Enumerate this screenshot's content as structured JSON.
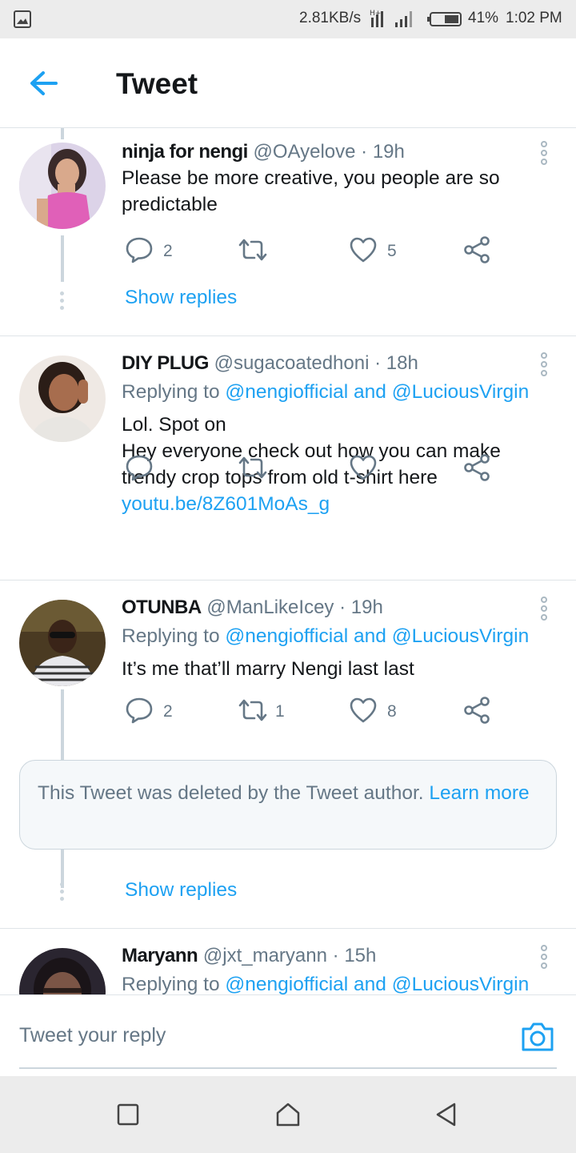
{
  "status_bar": {
    "net_speed": "2.81KB/s",
    "battery_percent": "41%",
    "time": "1:02 PM",
    "icons": [
      "image-icon",
      "signal-icon",
      "battery-icon"
    ]
  },
  "app_bar": {
    "title": "Tweet",
    "back_icon": "arrow-left-icon"
  },
  "colors": {
    "accent": "#1da1f2",
    "secondary_text": "#657786",
    "divider": "#dfe4e8",
    "primary_text": "#14171a"
  },
  "tweets": [
    {
      "name": "ninja for nengi",
      "handle": "@OAyelove",
      "sep": "·",
      "time": "19h",
      "text": "Please be more creative, you people are so predictable",
      "reply_count": "2",
      "retweet_count": "",
      "like_count": "5",
      "show_replies": "Show replies"
    },
    {
      "name": "DIY PLUG",
      "handle": "@sugacoatedhoni",
      "sep": "·",
      "time": "18h",
      "replying_prefix": "Replying to ",
      "replying_to_1": "@nengiofficial",
      "replying_and": " and ",
      "replying_to_2": "@LuciousVirgin",
      "text_line1": "Lol. Spot on",
      "text_line2": "Hey everyone check out how you can make trendy crop tops from old t-shirt here ",
      "link": "youtu.be/8Z601MoAs_g"
    },
    {
      "name": "OTUNBA",
      "handle": "@ManLikeIcey",
      "sep": "·",
      "time": "19h",
      "replying_prefix": "Replying to ",
      "replying_to_1": "@nengiofficial",
      "replying_and": " and ",
      "replying_to_2": "@LuciousVirgin",
      "text": "It’s me that’ll marry Nengi last last",
      "reply_count": "2",
      "retweet_count": "1",
      "like_count": "8",
      "deleted_notice": "This Tweet was deleted by the Tweet author. ",
      "deleted_link": "Learn more",
      "show_replies": "Show replies"
    },
    {
      "name": "Maryann",
      "handle": "@jxt_maryann",
      "sep": "·",
      "time": "15h",
      "replying_prefix": "Replying to ",
      "replying_to_1": "@nengiofficial",
      "replying_and": " and ",
      "replying_to_2": "@LuciousVirgin"
    }
  ],
  "reply_bar": {
    "placeholder": "Tweet your reply",
    "camera_icon": "camera-icon"
  },
  "nav_bar": {
    "icons": [
      "recents-square-icon",
      "home-icon",
      "back-triangle-icon"
    ]
  }
}
